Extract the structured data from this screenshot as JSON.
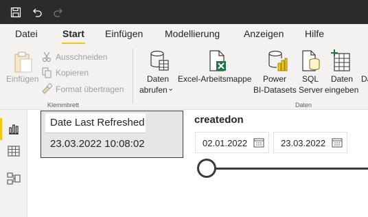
{
  "ribbon_tabs": [
    {
      "label": "Datei"
    },
    {
      "label": "Start"
    },
    {
      "label": "Einfügen"
    },
    {
      "label": "Modellierung"
    },
    {
      "label": "Anzeigen"
    },
    {
      "label": "Hilfe"
    }
  ],
  "clipboard": {
    "paste_label": "Einfügen",
    "cut_label": "Ausschneiden",
    "copy_label": "Kopieren",
    "format_painter_label": "Format übertragen",
    "group_label": "Klemmbrett"
  },
  "data_group": {
    "get_data_line1": "Daten",
    "get_data_line2": "abrufen",
    "get_data_chevron": "⌄",
    "excel_label": "Excel-Arbeitsmappe",
    "powerbi_line1": "Power",
    "powerbi_line2": "BI-Datasets",
    "sql_line1": "SQL",
    "sql_line2": "Server",
    "enter_data_line1": "Daten",
    "enter_data_line2": "eingeben",
    "truncated_label": "Da",
    "group_label": "Daten"
  },
  "card": {
    "label": "Date Last Refreshed",
    "value": "23.03.2022 10:08:02"
  },
  "slicer": {
    "title": "createdon",
    "start_date": "02.01.2022",
    "end_date": "23.03.2022",
    "position": 0
  },
  "colors": {
    "titlebar": "#2b2b2b",
    "ribbon_bg": "#f3f2f1",
    "accent": "#f2c811",
    "excel_green": "#217346"
  }
}
